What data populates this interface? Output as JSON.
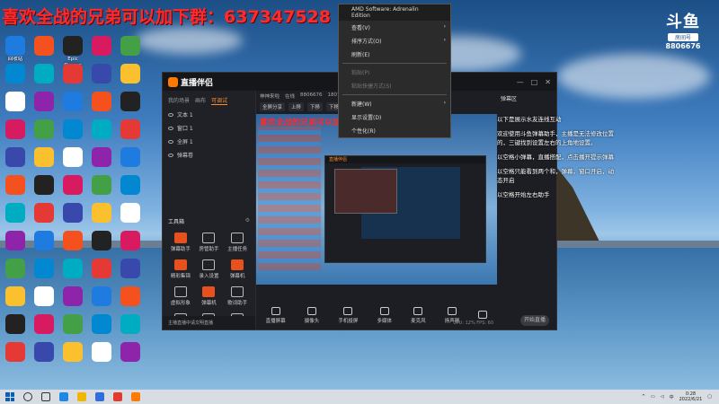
{
  "promo_text": "喜欢全战的兄弟可以加下群：637347528",
  "brand": {
    "logo_text": "斗鱼",
    "tag": "房间号",
    "room_number": "8806676"
  },
  "context_menu": {
    "header": "AMD Software: Adrenalin Edition",
    "items": [
      {
        "label": "查看(V)",
        "disabled": false,
        "arrow": true
      },
      {
        "label": "排序方式(O)",
        "disabled": false,
        "arrow": true
      },
      {
        "label": "刷新(E)",
        "disabled": false,
        "arrow": false
      },
      {
        "label": "粘贴(P)",
        "disabled": true,
        "arrow": false
      },
      {
        "label": "粘贴快捷方式(S)",
        "disabled": true,
        "arrow": false
      },
      {
        "label": "新建(W)",
        "disabled": false,
        "arrow": true
      },
      {
        "label": "显示设置(D)",
        "disabled": false,
        "arrow": false
      },
      {
        "label": "个性化(R)",
        "disabled": false,
        "arrow": false
      }
    ]
  },
  "desktop_icons": [
    "回收站",
    "",
    "Epic Games Launcher",
    "",
    "",
    "",
    "",
    "",
    "",
    "",
    "",
    "",
    "",
    "",
    "",
    "",
    "",
    "",
    "",
    "",
    "",
    "",
    "",
    "",
    "",
    "",
    "",
    "",
    "",
    "",
    "",
    "",
    "",
    "",
    "",
    "",
    "",
    "",
    "",
    "",
    "",
    "",
    "",
    "",
    "",
    "",
    "",
    "",
    "",
    "",
    "",
    "",
    "",
    "",
    "",
    "",
    "",
    "",
    "",
    "",
    "",
    "",
    "",
    "",
    "",
    "",
    "",
    "",
    "",
    "",
    "",
    "",
    "",
    "",
    "",
    "",
    "",
    "",
    "",
    ""
  ],
  "window": {
    "title": "直播伴侣",
    "tabs": [
      "我的场景",
      "画布",
      "可调试"
    ],
    "layers": [
      "文本 1",
      "窗口 1",
      "全屏 1",
      "弹幕卷"
    ],
    "tools_title": "工具箱",
    "tools": [
      {
        "label": "弹幕助手",
        "hot": true
      },
      {
        "label": "房管助手",
        "hot": false
      },
      {
        "label": "主播任务",
        "hot": false
      },
      {
        "label": "精彩集锦",
        "hot": true
      },
      {
        "label": "录入设置",
        "hot": false
      },
      {
        "label": "弹幕机",
        "hot": true
      },
      {
        "label": "虚拟形象",
        "hot": false
      },
      {
        "label": "弹幕机",
        "hot": true
      },
      {
        "label": "歌词助手",
        "hot": false
      },
      {
        "label": "",
        "hot": false
      },
      {
        "label": "",
        "hot": false
      },
      {
        "label": "",
        "hot": false
      }
    ],
    "footer_text": "主播直播中请文明直播",
    "info_items": [
      "神神来啦",
      "在线",
      "8806676",
      "1807",
      "67"
    ],
    "bar_items": [
      "全屏分享",
      "上移",
      "下移",
      "下移动"
    ],
    "preview_promo": "喜欢全战的兄弟可以加下群：637347528",
    "bottom_controls": [
      "直播屏幕",
      "摄像头",
      "手机投屏",
      "多媒体",
      "麦克风",
      "扬声器",
      ""
    ],
    "status_text": "CPU: 12%  FPS: 60",
    "right_title": "弹幕区",
    "start_label": "开始直播"
  },
  "chat_messages": [
    "以下是展示水友连线互动",
    "欢迎使用斗鱼弹幕助手，主播是无法修改位置的，三键找到设置左右的上角地设置。",
    "以空格小弹幕，直播搭配，点击播开提示弹幕",
    "以空格只能看到两个和，弹幕，窗口开启，动态开启",
    "以空格开始左右助手"
  ],
  "taskbar": {
    "time": "0:28",
    "date": "2022/6/21",
    "language": "中"
  }
}
